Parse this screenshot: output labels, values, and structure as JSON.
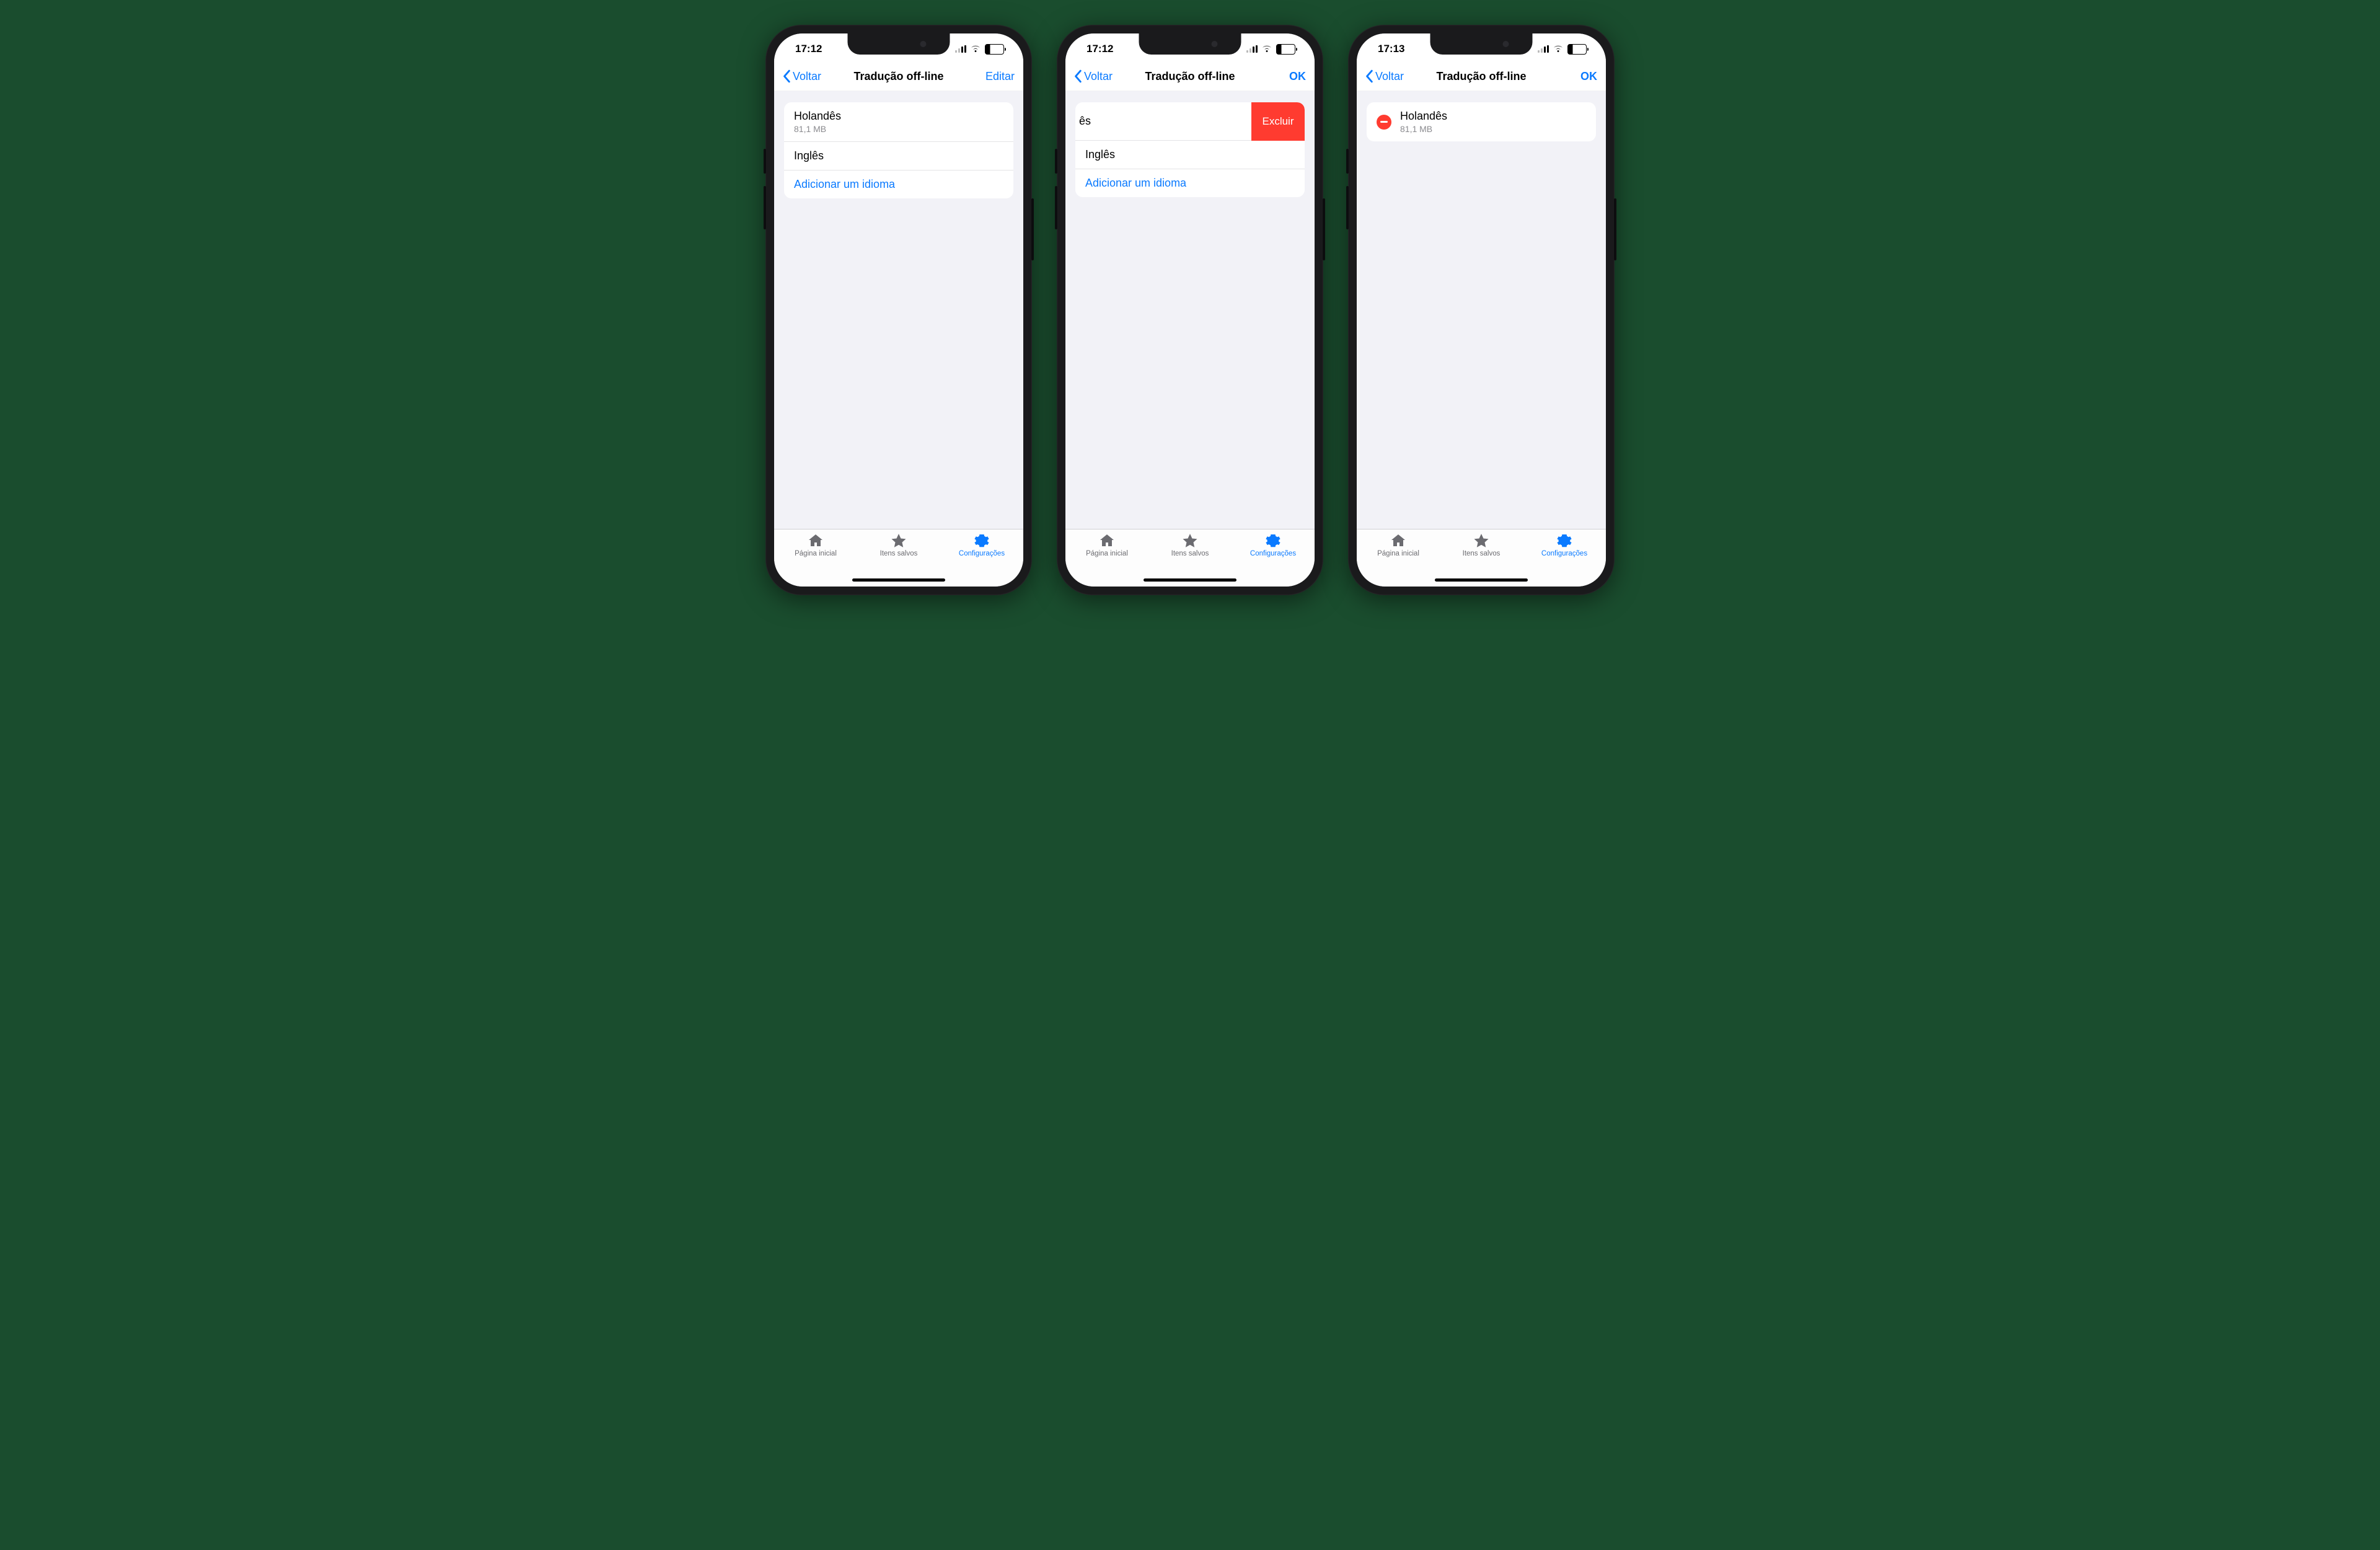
{
  "status": {
    "battery": "26"
  },
  "nav": {
    "back": "Voltar",
    "title": "Tradução off-line",
    "edit": "Editar",
    "ok": "OK"
  },
  "lang": {
    "dutch": "Holandês",
    "dutch_size": "81,1 MB",
    "english": "Inglês",
    "add": "Adicionar um idioma",
    "fragment": "ês",
    "delete": "Excluir"
  },
  "tabs": {
    "home": "Página inicial",
    "saved": "Itens salvos",
    "settings": "Configurações"
  },
  "times": {
    "a": "17:12",
    "b": "17:12",
    "c": "17:13"
  }
}
